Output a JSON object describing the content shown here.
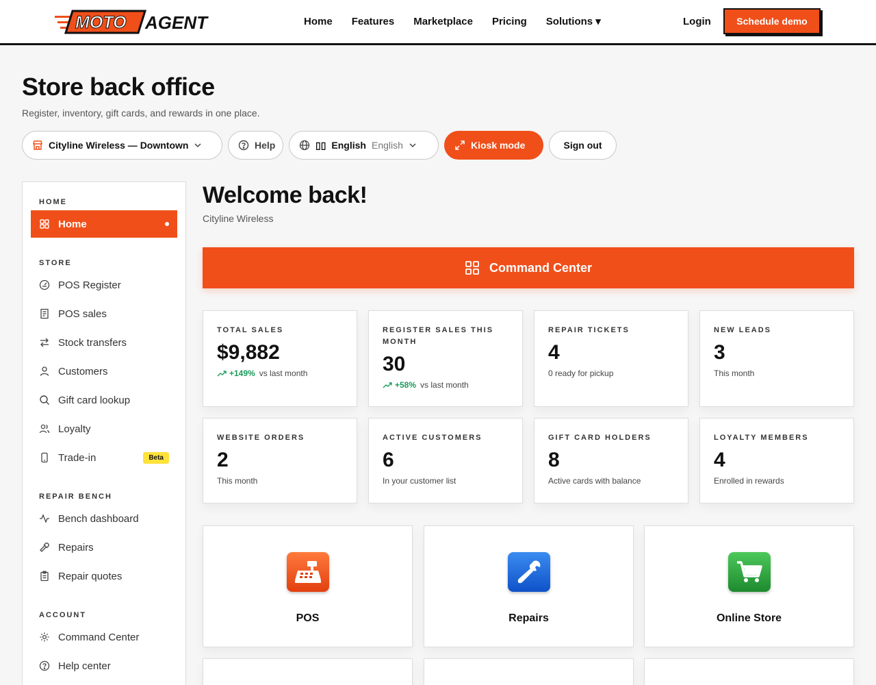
{
  "brand": {
    "moto": "MOTO",
    "agent": "AGENT",
    "accent": "#f04f1a"
  },
  "nav": {
    "links": [
      "Home",
      "Features",
      "Marketplace",
      "Pricing",
      "Solutions ▾"
    ],
    "login": "Login",
    "demo": "Schedule demo"
  },
  "header": {
    "title": "Store back office",
    "subtitle": "Register, inventory, gift cards, and rewards in one place."
  },
  "controls": {
    "store": "Cityline Wireless — Downtown",
    "help": "Help",
    "lang_flag": "▯▯",
    "lang_name": "English",
    "lang_native": "English",
    "kiosk": "Kiosk mode",
    "signout": "Sign out"
  },
  "sidebar": {
    "sections": {
      "home": "HOME",
      "store": "STORE",
      "repair": "REPAIR BENCH",
      "account": "ACCOUNT"
    },
    "items": {
      "home": "Home",
      "pos_register": "POS Register",
      "pos_sales": "POS sales",
      "stock_transfers": "Stock transfers",
      "customers": "Customers",
      "gift_card_lookup": "Gift card lookup",
      "loyalty": "Loyalty",
      "trade_in": "Trade-in",
      "beta": "Beta",
      "bench_dashboard": "Bench dashboard",
      "repairs": "Repairs",
      "repair_quotes": "Repair quotes",
      "command_center": "Command Center",
      "help_center": "Help center"
    }
  },
  "main": {
    "welcome": "Welcome back!",
    "store_name": "Cityline Wireless",
    "command_center": "Command Center"
  },
  "stats": [
    {
      "label": "Total sales",
      "value": "$9,882",
      "change": "+149%",
      "note": "vs last month"
    },
    {
      "label": "Register sales this month",
      "value": "30",
      "change": "+58%",
      "note": "vs last month"
    },
    {
      "label": "Repair tickets",
      "value": "4",
      "note": "0 ready for pickup"
    },
    {
      "label": "New leads",
      "value": "3",
      "note": "This month"
    },
    {
      "label": "Website orders",
      "value": "2",
      "note": "This month"
    },
    {
      "label": "Active customers",
      "value": "6",
      "note": "In your customer list"
    },
    {
      "label": "Gift card holders",
      "value": "8",
      "note": "Active cards with balance"
    },
    {
      "label": "Loyalty members",
      "value": "4",
      "note": "Enrolled in rewards"
    }
  ],
  "apps": [
    {
      "name": "POS",
      "icon": "cash-register-icon"
    },
    {
      "name": "Repairs",
      "icon": "wrench-icon"
    },
    {
      "name": "Online Store",
      "icon": "shopping-cart-icon"
    }
  ]
}
